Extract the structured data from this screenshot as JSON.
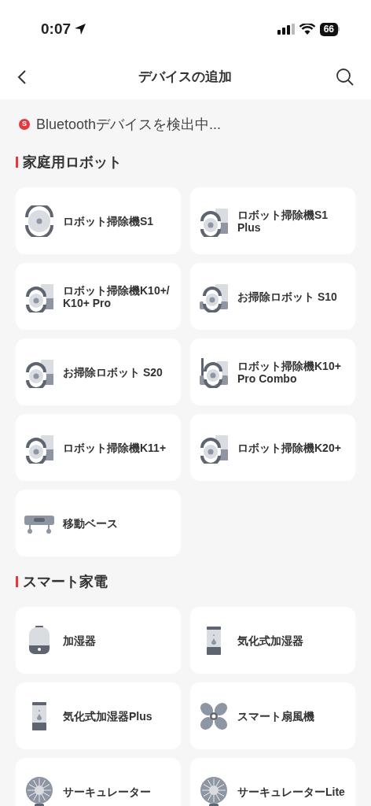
{
  "status_bar": {
    "time": "0:07",
    "battery": "66"
  },
  "header": {
    "title": "デバイスの追加"
  },
  "scan_notice": {
    "badge": "S",
    "text": "Bluetoothデバイスを検出中..."
  },
  "sections": [
    {
      "title": "家庭用ロボット",
      "devices": [
        {
          "name": "ロボット掃除機S1",
          "kind": "robot"
        },
        {
          "name": "ロボット掃除機S1\nPlus",
          "kind": "dock"
        },
        {
          "name": "ロボット掃除機K10+/\nK10+ Pro",
          "kind": "dock"
        },
        {
          "name": "お掃除ロボット S10",
          "kind": "dockwide"
        },
        {
          "name": "お掃除ロボット S20",
          "kind": "dock"
        },
        {
          "name": "ロボット掃除機K10+\nPro Combo",
          "kind": "combo"
        },
        {
          "name": "ロボット掃除機K11+",
          "kind": "dock"
        },
        {
          "name": "ロボット掃除機K20+",
          "kind": "dock"
        },
        {
          "name": "移動ベース",
          "kind": "base"
        }
      ]
    },
    {
      "title": "スマート家電",
      "devices": [
        {
          "name": "加湿器",
          "kind": "humidifier"
        },
        {
          "name": "気化式加湿器",
          "kind": "evaporative"
        },
        {
          "name": "気化式加湿器Plus",
          "kind": "evaporative"
        },
        {
          "name": "スマート扇風機",
          "kind": "fan"
        },
        {
          "name": "サーキュレーター",
          "kind": "circulator"
        },
        {
          "name": "サーキュレーターLite",
          "kind": "circulator"
        }
      ]
    }
  ]
}
